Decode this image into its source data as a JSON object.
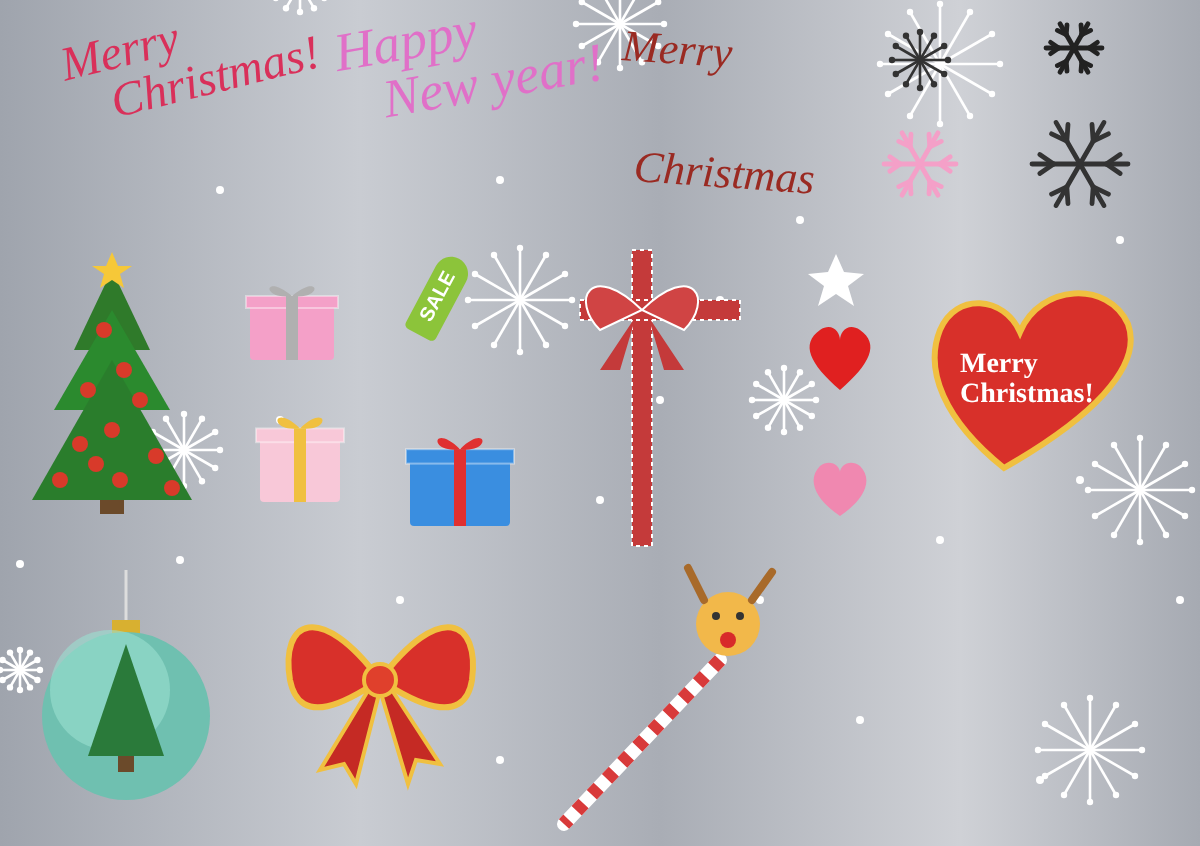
{
  "greetings": [
    {
      "lines": [
        "Merry",
        "Christmas!"
      ]
    },
    {
      "lines": [
        "Happy",
        "New year!"
      ]
    },
    {
      "lines": [
        "Merry",
        "Christmas"
      ]
    }
  ],
  "sale_tag": {
    "text": "SALE"
  },
  "heart_card": {
    "lines": [
      "Merry",
      "Christmas!"
    ]
  }
}
